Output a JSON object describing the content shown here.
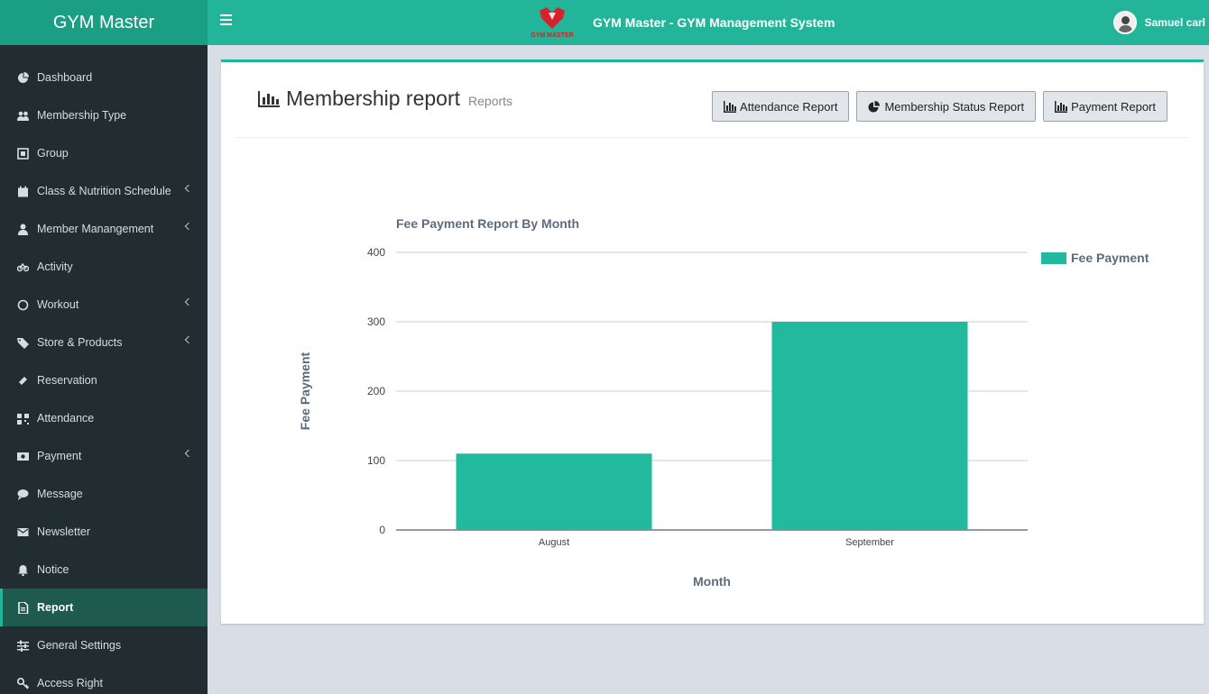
{
  "app": {
    "logo_text": "GYM Master",
    "title": "GYM Master - GYM Management System",
    "brand_logo_label": "GYM MASTER",
    "user_name": "Samuel carl"
  },
  "sidebar": {
    "items": [
      {
        "label": "Dashboard",
        "icon": "dashboard-icon",
        "chevron": false
      },
      {
        "label": "Membership Type",
        "icon": "users-icon",
        "chevron": false
      },
      {
        "label": "Group",
        "icon": "group-icon",
        "chevron": false
      },
      {
        "label": "Class & Nutrition Schedule",
        "icon": "calendar-icon",
        "chevron": true
      },
      {
        "label": "Member Manangement",
        "icon": "user-icon",
        "chevron": true
      },
      {
        "label": "Activity",
        "icon": "bicycle-icon",
        "chevron": false
      },
      {
        "label": "Workout",
        "icon": "workout-icon",
        "chevron": true
      },
      {
        "label": "Store & Products",
        "icon": "tag-icon",
        "chevron": true
      },
      {
        "label": "Reservation",
        "icon": "ticket-icon",
        "chevron": false
      },
      {
        "label": "Attendance",
        "icon": "qrcode-icon",
        "chevron": false
      },
      {
        "label": "Payment",
        "icon": "money-icon",
        "chevron": true
      },
      {
        "label": "Message",
        "icon": "comment-icon",
        "chevron": false
      },
      {
        "label": "Newsletter",
        "icon": "envelope-icon",
        "chevron": false
      },
      {
        "label": "Notice",
        "icon": "bell-icon",
        "chevron": false
      },
      {
        "label": "Report",
        "icon": "file-icon",
        "chevron": false,
        "active": true
      },
      {
        "label": "General Settings",
        "icon": "sliders-icon",
        "chevron": false
      },
      {
        "label": "Access Right",
        "icon": "key-icon",
        "chevron": false
      }
    ]
  },
  "page": {
    "title": "Membership report",
    "subtitle": "Reports",
    "buttons": {
      "attendance": "Attendance Report",
      "membership_status": "Membership Status Report",
      "payment": "Payment Report"
    }
  },
  "colors": {
    "accent": "#22b59a",
    "header_dark": "#1a9e84",
    "sidebar": "#222d32",
    "bar": "#22b99f"
  },
  "chart_data": {
    "type": "bar",
    "title": "Fee Payment Report By Month",
    "xlabel": "Month",
    "ylabel": "Fee Payment",
    "categories": [
      "August",
      "September"
    ],
    "series": [
      {
        "name": "Fee Payment",
        "values": [
          110,
          300
        ]
      }
    ],
    "ylim": [
      0,
      400
    ],
    "yticks": [
      0,
      100,
      200,
      300,
      400
    ],
    "grid": true,
    "legend": "right"
  }
}
